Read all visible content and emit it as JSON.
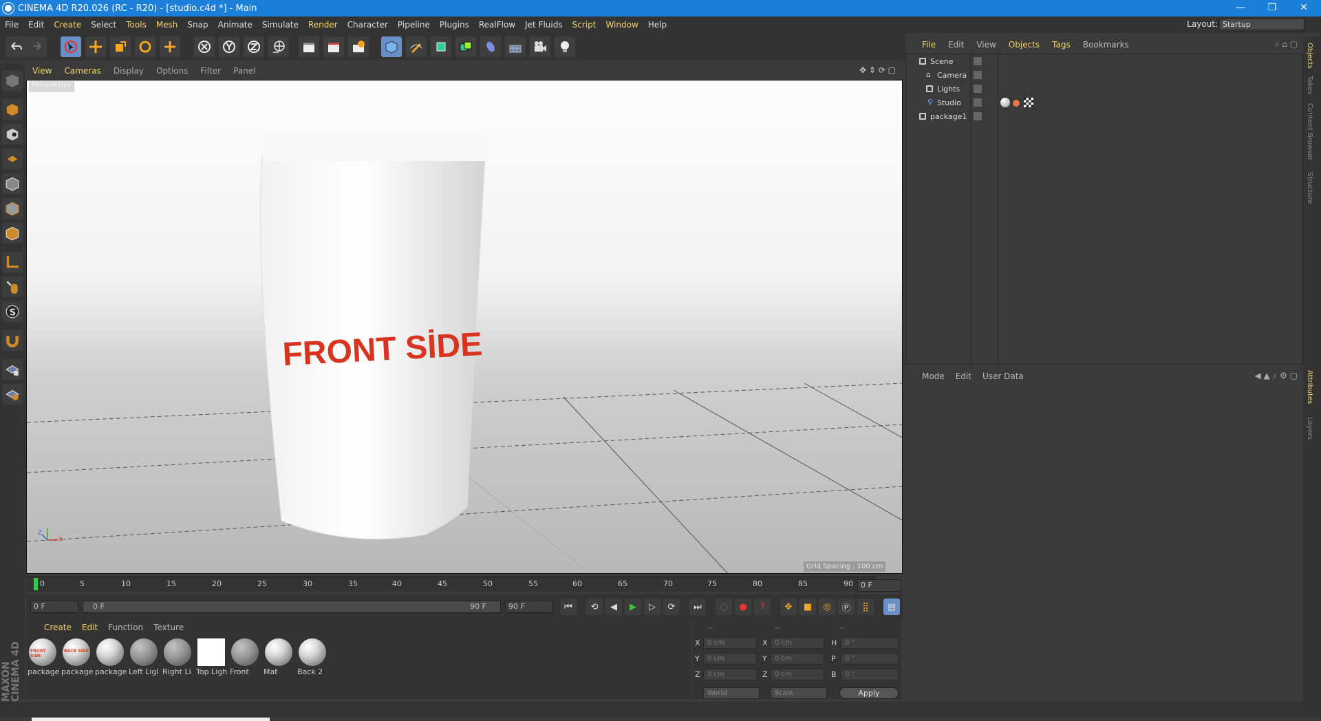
{
  "window": {
    "title": "CINEMA 4D R20.026 (RC - R20) - [studio.c4d *] - Main",
    "minimize": "—",
    "restore": "❐",
    "close": "✕"
  },
  "menu": {
    "items": [
      "File",
      "Edit",
      "Create",
      "Select",
      "Tools",
      "Mesh",
      "Snap",
      "Animate",
      "Simulate",
      "Render",
      "Character",
      "Pipeline",
      "Plugins",
      "RealFlow",
      "Jet Fluids",
      "Script",
      "Window",
      "Help"
    ],
    "layout_label": "Layout:",
    "layout_value": "Startup"
  },
  "viewport": {
    "menu": [
      "View",
      "Cameras",
      "Display",
      "Options",
      "Filter",
      "Panel"
    ],
    "label": "Perspective",
    "grid_spacing": "Grid Spacing : 100 cm",
    "product_text": "FRONT SİDE",
    "axis_y": "Y",
    "axis_z": "Z",
    "axis_x": "X"
  },
  "timeline": {
    "ticks": [
      "0",
      "5",
      "10",
      "15",
      "20",
      "25",
      "30",
      "35",
      "40",
      "45",
      "50",
      "55",
      "60",
      "65",
      "70",
      "75",
      "80",
      "85",
      "90"
    ],
    "current": "0 F",
    "start": "0 F",
    "range_start": "0 F",
    "range_end": "90 F",
    "end": "90 F"
  },
  "materials": {
    "menu": [
      "Create",
      "Edit",
      "Function",
      "Texture"
    ],
    "items": [
      {
        "name": "package",
        "stamp": "FRONT SIDE"
      },
      {
        "name": "package",
        "stamp": "BACK SIDE"
      },
      {
        "name": "package",
        "stamp": ""
      },
      {
        "name": "Left Ligl",
        "stamp": ""
      },
      {
        "name": "Right Li",
        "stamp": ""
      },
      {
        "name": "Top Ligh",
        "stamp": ""
      },
      {
        "name": "Front",
        "stamp": ""
      },
      {
        "name": "Mat",
        "stamp": ""
      },
      {
        "name": "Back 2",
        "stamp": ""
      }
    ]
  },
  "coordinates": {
    "headers": [
      "--",
      "--",
      "--"
    ],
    "rows": [
      {
        "a": "X",
        "v1": "0 cm",
        "b": "X",
        "v2": "0 cm",
        "c": "H",
        "v3": "0 °"
      },
      {
        "a": "Y",
        "v1": "0 cm",
        "b": "Y",
        "v2": "0 cm",
        "c": "P",
        "v3": "0 °"
      },
      {
        "a": "Z",
        "v1": "0 cm",
        "b": "Z",
        "v2": "0 cm",
        "c": "B",
        "v3": "0 °"
      }
    ],
    "space": "World",
    "mode": "Scale",
    "apply": "Apply"
  },
  "objects": {
    "menu": [
      "File",
      "Edit",
      "View",
      "Objects",
      "Tags",
      "Bookmarks"
    ],
    "tree": [
      {
        "name": "Scene"
      },
      {
        "name": "Camera"
      },
      {
        "name": "Lights"
      },
      {
        "name": "Studio"
      },
      {
        "name": "package1"
      }
    ]
  },
  "attributes": {
    "menu": [
      "Mode",
      "Edit",
      "User Data"
    ]
  },
  "right_tabs": [
    "Objects",
    "Takes",
    "Content Browser",
    "Structure",
    "Attributes",
    "Layers"
  ]
}
